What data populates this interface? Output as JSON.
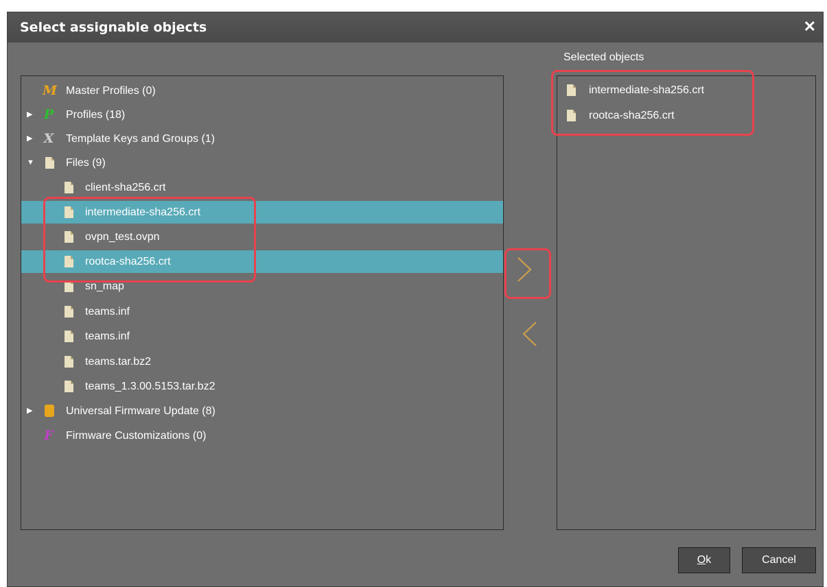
{
  "dialog": {
    "title": "Select assignable objects",
    "close_glyph": "✕"
  },
  "left_tree": {
    "nodes": [
      {
        "label": "Master Profiles (0)",
        "icon": "master-profile-icon",
        "glyph": "M",
        "color": "#e8a51e"
      },
      {
        "label": "Profiles (18)",
        "icon": "profile-icon",
        "glyph": "P",
        "color": "#2dbe2d",
        "collapsed_glyph": "▶"
      },
      {
        "label": "Template Keys and Groups (1)",
        "icon": "template-key-icon",
        "glyph": "X",
        "color": "#cfcfcf",
        "collapsed_glyph": "▶"
      },
      {
        "label": "Files (9)",
        "icon": "file-icon",
        "expanded_glyph": "▼"
      },
      {
        "label": "Universal Firmware Update (8)",
        "icon": "firmware-update-icon",
        "collapsed_glyph": "▶"
      },
      {
        "label": "Firmware Customizations (0)",
        "icon": "firmware-customization-icon",
        "glyph": "F",
        "color": "#c040c8"
      }
    ],
    "files": [
      {
        "label": "client-sha256.crt",
        "selected": false
      },
      {
        "label": "intermediate-sha256.crt",
        "selected": true
      },
      {
        "label": "ovpn_test.ovpn",
        "selected": false
      },
      {
        "label": "rootca-sha256.crt",
        "selected": true
      },
      {
        "label": "sn_map",
        "selected": false
      },
      {
        "label": "teams.inf",
        "selected": false
      },
      {
        "label": "teams.inf",
        "selected": false
      },
      {
        "label": "teams.tar.bz2",
        "selected": false
      },
      {
        "label": "teams_1.3.00.5153.tar.bz2",
        "selected": false
      }
    ]
  },
  "right_panel": {
    "label": "Selected objects",
    "items": [
      {
        "label": "intermediate-sha256.crt"
      },
      {
        "label": "rootca-sha256.crt"
      }
    ]
  },
  "buttons": {
    "ok_mnemonic": "O",
    "ok_rest": "k",
    "cancel": "Cancel"
  },
  "colors": {
    "selection": "#59aab8",
    "highlight": "#e8434d",
    "arrow": "#d3a24a",
    "background": "#6e6e6e"
  }
}
